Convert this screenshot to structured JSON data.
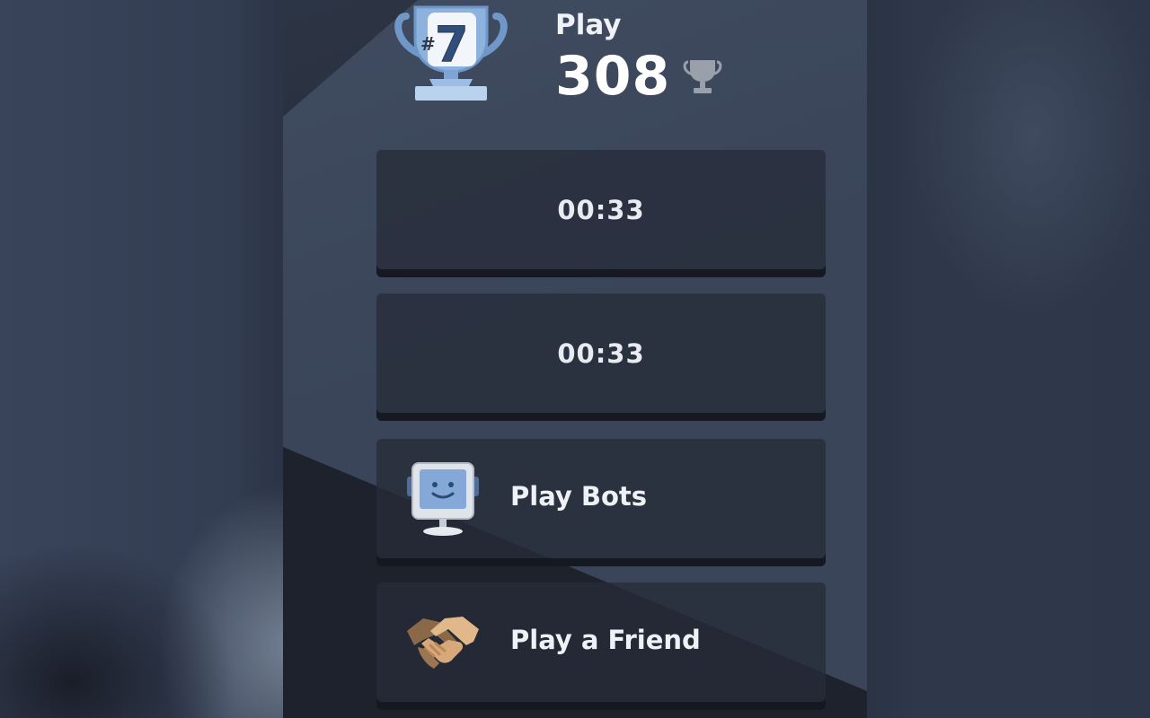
{
  "header": {
    "title": "Play",
    "rating": "308",
    "rank_hash": "#",
    "rank_number": "7"
  },
  "timers": [
    {
      "label": "00:33"
    },
    {
      "label": "00:33"
    }
  ],
  "options": {
    "bots_label": "Play Bots",
    "friend_label": "Play a Friend"
  },
  "icons": {
    "rank": "trophy-rank-icon",
    "rating_trophy": "trophy-icon",
    "bots": "computer-bot-icon",
    "friend": "handshake-icon"
  },
  "colors": {
    "panel": "#3a4559",
    "button": "#262c38",
    "trophy_blue": "#7da4d4",
    "trophy_light": "#c7daf0",
    "rating_trophy": "#9aa0aa"
  }
}
